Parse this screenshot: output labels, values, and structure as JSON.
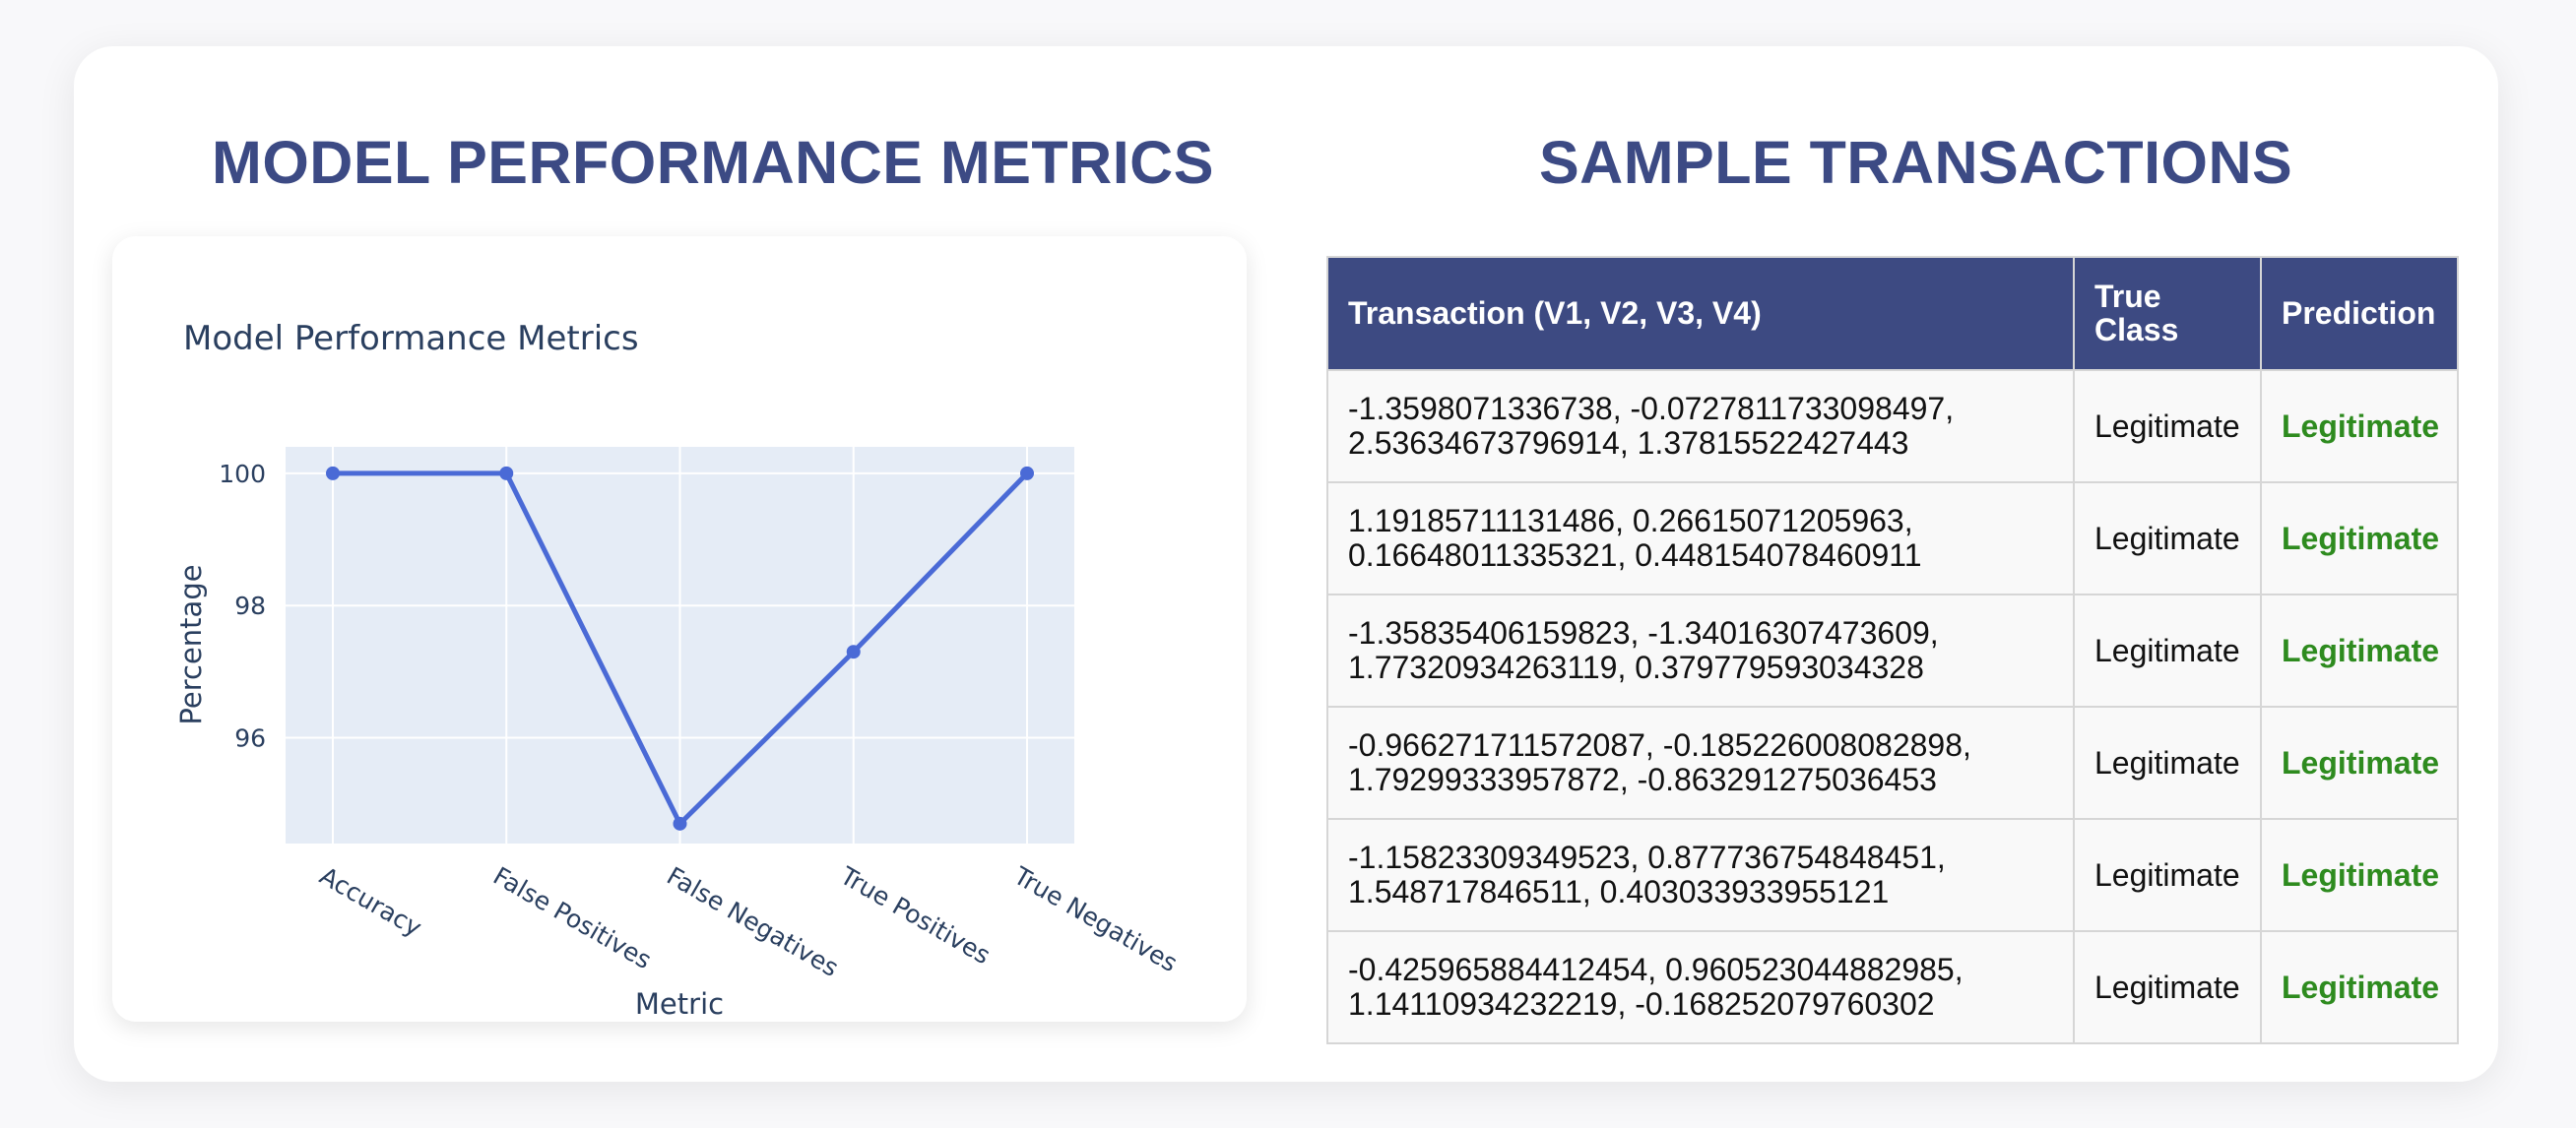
{
  "left_section": {
    "title": "MODEL PERFORMANCE METRICS"
  },
  "right_section": {
    "title": "SAMPLE TRANSACTIONS"
  },
  "chart_data": {
    "type": "line",
    "title": "Model Performance Metrics",
    "xlabel": "Metric",
    "ylabel": "Percentage",
    "categories": [
      "Accuracy",
      "False Positives",
      "False Negatives",
      "True Positives",
      "True Negatives"
    ],
    "values": [
      100,
      100,
      94.7,
      97.3,
      100
    ],
    "yticks": [
      96,
      98,
      100
    ],
    "ylim": [
      94.4,
      100.4
    ],
    "grid": true,
    "colors": {
      "line": "#4a6ad6",
      "plot_background": "#e5ecf6",
      "grid": "#ffffff",
      "text": "#2a3f5f"
    }
  },
  "table": {
    "headers": [
      "Transaction (V1, V2, V3, V4)",
      "True Class",
      "Prediction"
    ],
    "rows": [
      {
        "tx_line1": "-1.3598071336738, -0.0727811733098497,",
        "tx_line2": "2.53634673796914, 1.37815522427443",
        "true_class": "Legitimate",
        "prediction": "Legitimate"
      },
      {
        "tx_line1": "1.19185711131486, 0.26615071205963,",
        "tx_line2": "0.16648011335321, 0.448154078460911",
        "true_class": "Legitimate",
        "prediction": "Legitimate"
      },
      {
        "tx_line1": "-1.35835406159823, -1.34016307473609,",
        "tx_line2": "1.77320934263119, 0.379779593034328",
        "true_class": "Legitimate",
        "prediction": "Legitimate"
      },
      {
        "tx_line1": "-0.966271711572087, -0.185226008082898,",
        "tx_line2": "1.79299333957872, -0.863291275036453",
        "true_class": "Legitimate",
        "prediction": "Legitimate"
      },
      {
        "tx_line1": "-1.15823309349523, 0.877736754848451,",
        "tx_line2": "1.548717846511, 0.403033933955121",
        "true_class": "Legitimate",
        "prediction": "Legitimate"
      },
      {
        "tx_line1": "-0.425965884412454, 0.960523044882985,",
        "tx_line2": "1.14110934232219, -0.168252079760302",
        "true_class": "Legitimate",
        "prediction": "Legitimate"
      }
    ],
    "colors": {
      "header_bg": "#3d4a82",
      "prediction_text": "#2e8b1f"
    }
  }
}
